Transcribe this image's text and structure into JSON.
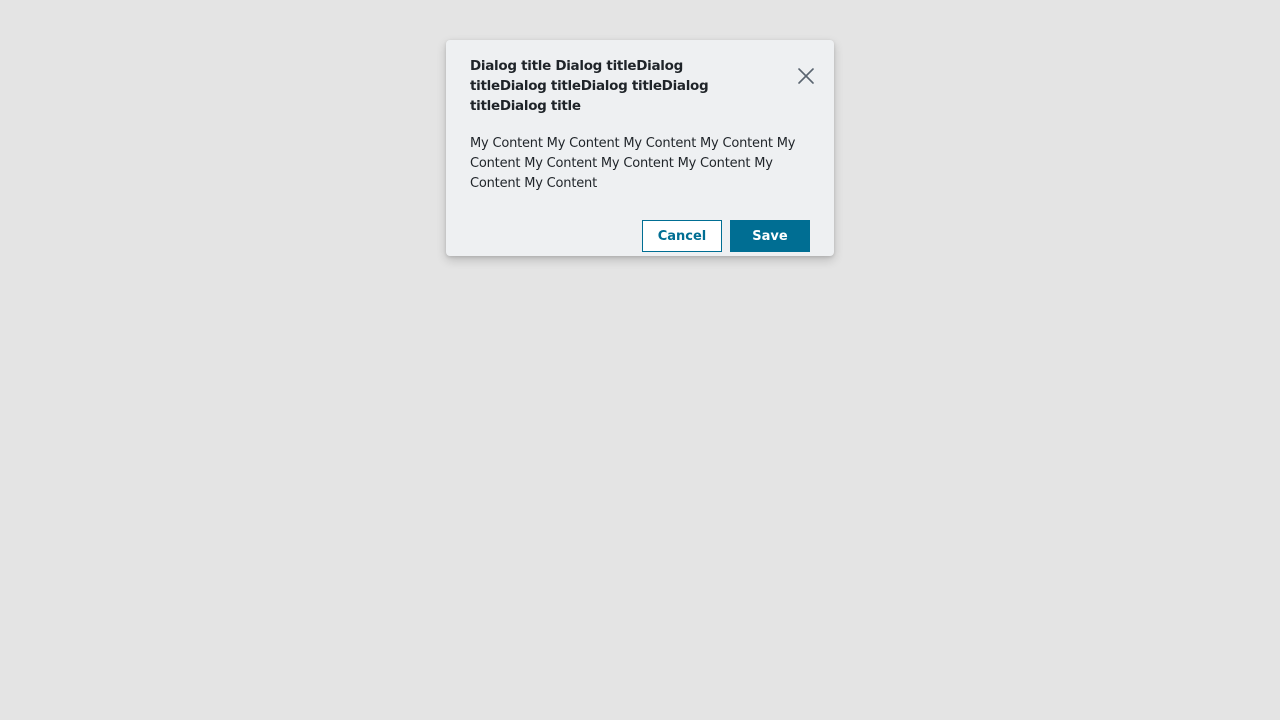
{
  "dialog": {
    "title": "Dialog title Dialog titleDialog titleDialog titleDialog titleDialog titleDialog title",
    "content": "My Content My Content My Content My Content My Content My Content My Content My Content My Content My Content",
    "close_icon": "close-icon",
    "buttons": {
      "cancel_label": "Cancel",
      "save_label": "Save"
    }
  },
  "colors": {
    "backdrop": "#e4e4e4",
    "dialog_background": "#eef0f2",
    "primary": "#006e93",
    "text": "#1f2429"
  }
}
